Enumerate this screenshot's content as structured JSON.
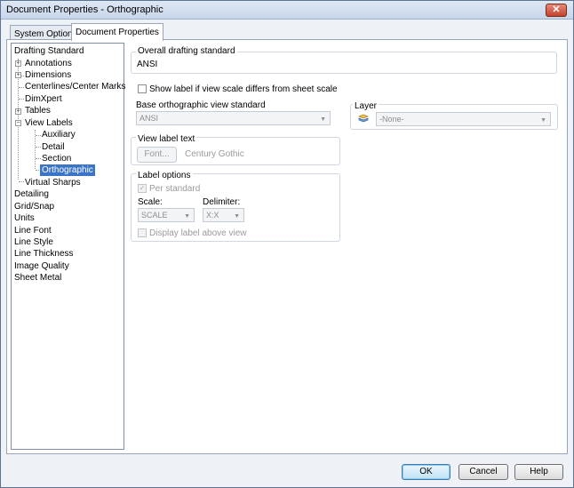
{
  "window": {
    "title": "Document Properties - Orthographic",
    "close_glyph": "✕"
  },
  "tabs": [
    {
      "label": "System Options"
    },
    {
      "label": "Document Properties"
    }
  ],
  "tree": [
    {
      "label": "Drafting Standard"
    },
    {
      "label": "Annotations"
    },
    {
      "label": "Dimensions"
    },
    {
      "label": "Centerlines/Center Marks"
    },
    {
      "label": "DimXpert"
    },
    {
      "label": "Tables"
    },
    {
      "label": "View Labels"
    },
    {
      "label": "Auxiliary"
    },
    {
      "label": "Detail"
    },
    {
      "label": "Section"
    },
    {
      "label": "Orthographic"
    },
    {
      "label": "Virtual Sharps"
    },
    {
      "label": "Detailing"
    },
    {
      "label": "Grid/Snap"
    },
    {
      "label": "Units"
    },
    {
      "label": "Line Font"
    },
    {
      "label": "Line Style"
    },
    {
      "label": "Line Thickness"
    },
    {
      "label": "Image Quality"
    },
    {
      "label": "Sheet Metal"
    }
  ],
  "overall": {
    "title": "Overall drafting standard",
    "value": "ANSI"
  },
  "show_label": {
    "label": "Show label if view scale differs from sheet scale",
    "checked": false
  },
  "base_std": {
    "title": "Base orthographic view standard",
    "value": "ANSI"
  },
  "layer": {
    "title": "Layer",
    "value": "-None-",
    "icon": "layer-icon"
  },
  "view_label_text": {
    "title": "View label text",
    "font_button": "Font...",
    "font_name": "Century Gothic"
  },
  "label_options": {
    "title": "Label options",
    "per_standard": "Per standard",
    "scale_label": "Scale:",
    "scale_value": "SCALE",
    "delimiter_label": "Delimiter:",
    "delimiter_value": "X:X",
    "display_above": "Display label above view"
  },
  "buttons": {
    "ok": "OK",
    "cancel": "Cancel",
    "help": "Help"
  },
  "colors": {
    "selection": "#3a74c9",
    "title_bar": "#c7d6ea"
  }
}
